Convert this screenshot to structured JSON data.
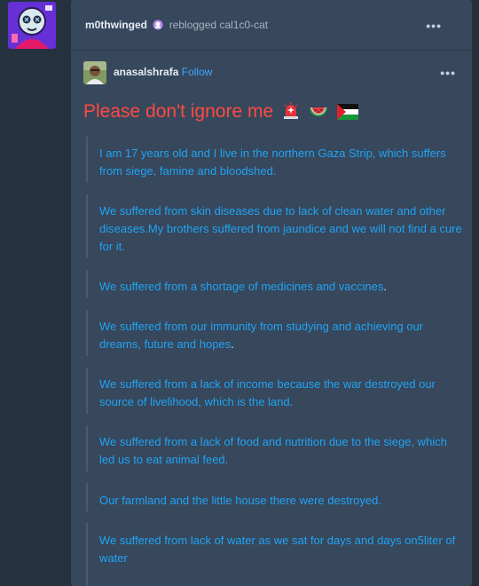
{
  "reblog": {
    "blog_name": "m0thwinged",
    "action": "reblogged",
    "source_blog": "cal1c0-cat",
    "more_label": "•••"
  },
  "post": {
    "author": "anasalshrafa",
    "follow_label": "Follow",
    "more_label": "•••",
    "title": "Please don't ignore me",
    "title_emojis": [
      "siren-icon",
      "watermelon-icon",
      "palestine-flag-icon"
    ],
    "paragraphs": [
      "I am 17 years old and I live in the northern Gaza Strip, which suffers from siege, famine and bloodshed.",
      "We suffered from skin diseases due to lack of clean water and other diseases.My brothers suffered from jaundice and we will not find a cure for it.",
      "We suffered from a shortage of medicines and vaccines",
      "We suffered from our immunity from studying and achieving our dreams, future and hopes",
      "We suffered from a lack of income because the war destroyed our source of livelihood, which is the land.",
      "We suffered from a lack of food and nutrition due to the siege, which led us to eat animal feed.",
      "Our farmland and the little house there were destroyed.",
      "We suffered from lack of water as we sat for days and days on5liter of water"
    ],
    "trailing_periods": [
      ".",
      "."
    ]
  },
  "colors": {
    "background": "#263140",
    "card": "#37475c",
    "title": "#ff4a3f",
    "body_text": "#20a4f3",
    "follow": "#3fa6ff"
  }
}
